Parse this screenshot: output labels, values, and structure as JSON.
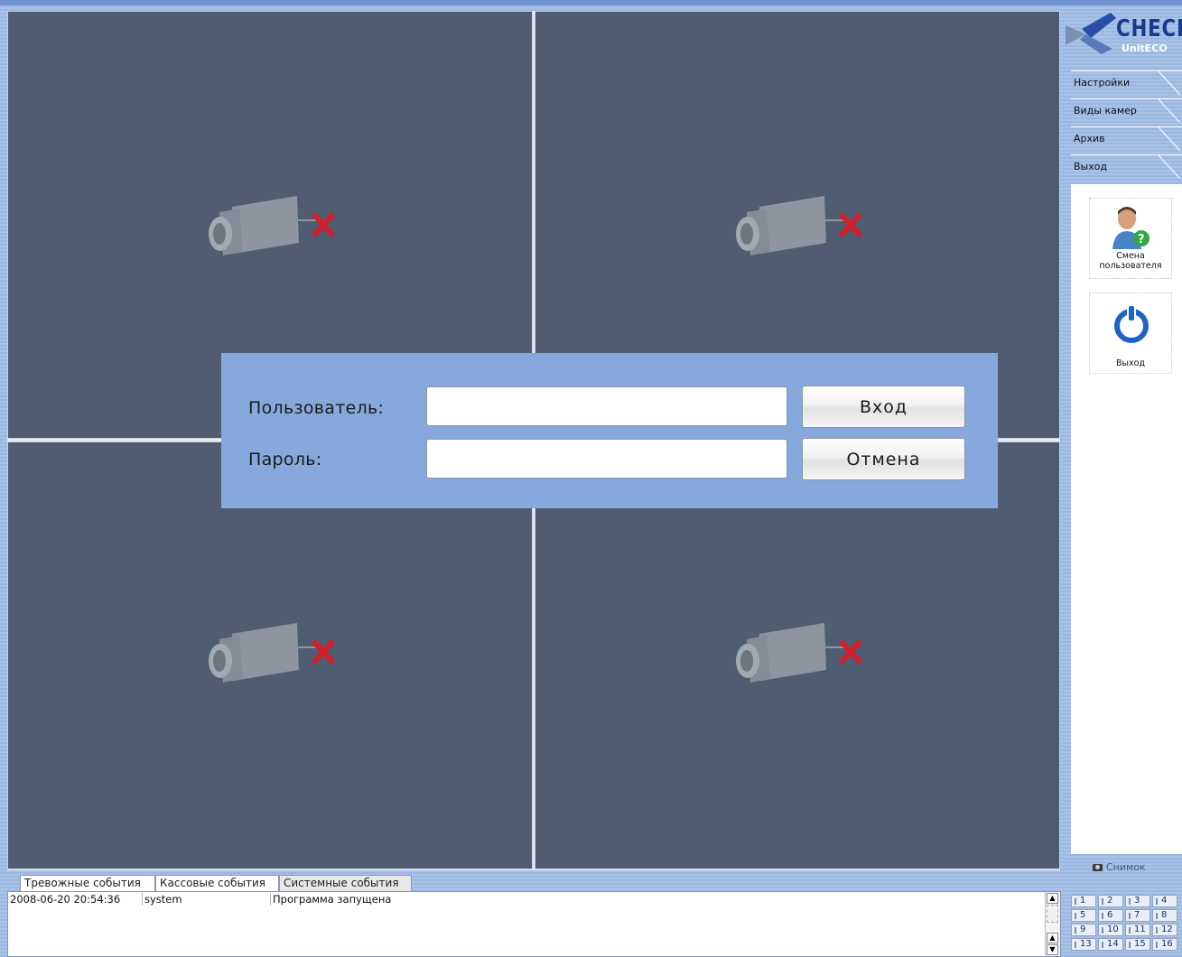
{
  "menu": {
    "items": [
      "Настройки",
      "Виды камер",
      "Архив",
      "Выход"
    ]
  },
  "logo": {
    "brand": "CHECK",
    "sub": "UnitECO"
  },
  "panel": {
    "change_user": "Смена пользователя",
    "exit": "Выход",
    "snapshot": "Снимок"
  },
  "login": {
    "user_label": "Пользователь:",
    "password_label": "Пароль:",
    "user_value": "",
    "password_value": "",
    "login_button": "Вход",
    "cancel_button": "Отмена"
  },
  "tabs": [
    "Тревожные события",
    "Кассовые события",
    "Системные события"
  ],
  "events": [
    {
      "time": "2008-06-20 20:54:36",
      "source": "system",
      "message": "Программа запущена"
    }
  ],
  "camera_numbers": [
    "1",
    "2",
    "3",
    "4",
    "5",
    "6",
    "7",
    "8",
    "9",
    "10",
    "11",
    "12",
    "13",
    "14",
    "15",
    "16"
  ],
  "colors": {
    "cell_bg": "#4f5c71",
    "dialog_bg": "#86a8dd",
    "no_signal_x": "#d0202a"
  }
}
